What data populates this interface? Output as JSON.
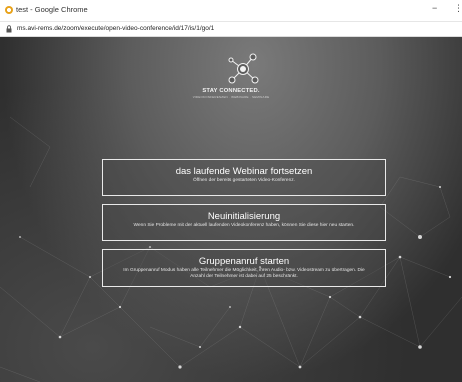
{
  "window": {
    "title": "test - Google Chrome",
    "minimize_glyph": "−",
    "more_glyph": "⋮"
  },
  "address_bar": {
    "url": "ms.avi-rems.de/zoom/execute/open-video-conference/id/17/is/1/go/1"
  },
  "header": {
    "brand": "STAY CONNECTED.",
    "tagline": "VIDEOKONFERENZEN · WEBINARE · SEMINARE"
  },
  "options": [
    {
      "title": "das laufende Webinar fortsetzen",
      "description": "Öffnen der bereits gestarteten Video-Konferenz."
    },
    {
      "title": "Neuinitialisierung",
      "description": "Wenn Sie Probleme mit der aktuell laufenden Videokonferenz haben, können Sie diese hier neu starten."
    },
    {
      "title": "Gruppenanruf starten",
      "description": "Im Gruppenanruf Modus haben alle Teilnehmer die Möglichkeit, ihren Audio- bzw. Videostream zu übertragen. Die Anzahl der Teilnehmer ist dabei auf 25 beschränkt."
    }
  ],
  "colors": {
    "app_icon": "#e8a21a",
    "card_border": "#e9e9e9",
    "page_background": "#3a3a3a"
  },
  "icons": {
    "app": "chrome-app-icon",
    "lock": "lock-icon",
    "logo": "network-nodes-logo-icon"
  }
}
